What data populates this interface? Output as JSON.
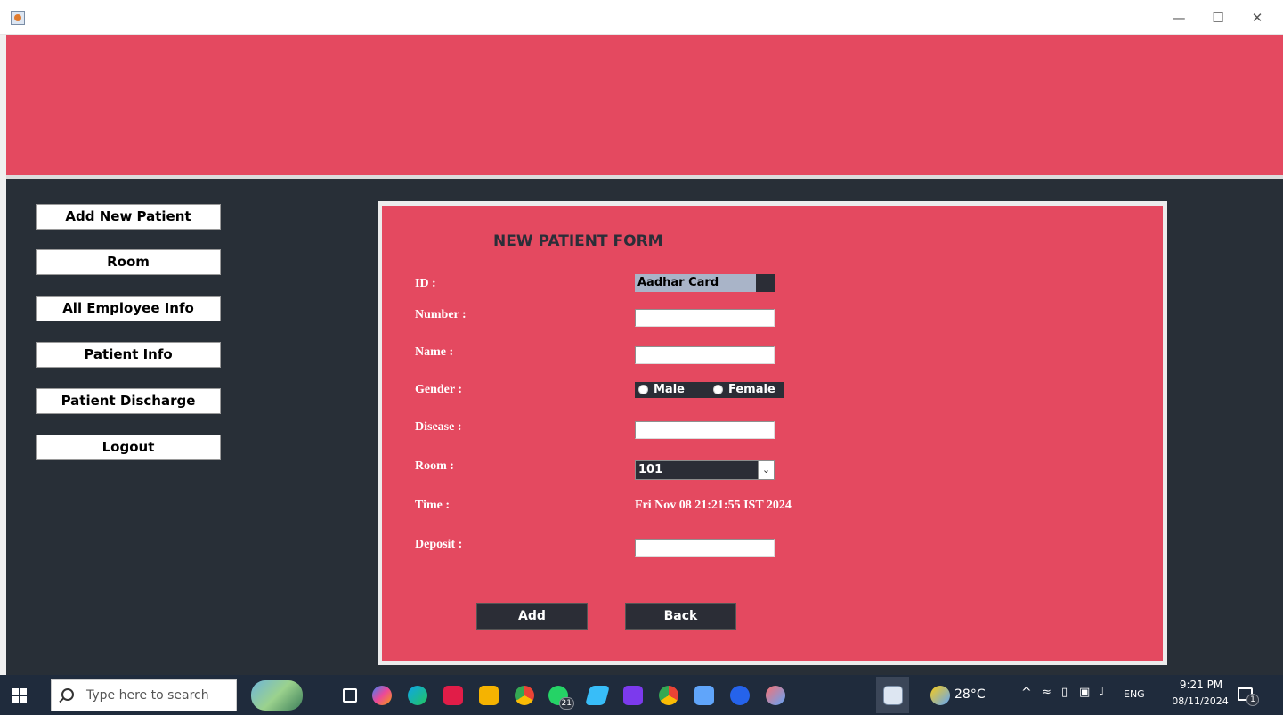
{
  "window": {
    "controls": {
      "minimize": "—",
      "maximize": "☐",
      "close": "✕"
    }
  },
  "colors": {
    "accent": "#e44960",
    "dark_background": "#282f37",
    "dark_field": "#2b2d36",
    "taskbar": "#1f2b3c"
  },
  "sidebar": {
    "items": [
      {
        "label": "Add New Patient"
      },
      {
        "label": "Room"
      },
      {
        "label": "All Employee Info"
      },
      {
        "label": "Patient Info"
      },
      {
        "label": "Patient Discharge"
      },
      {
        "label": "Logout"
      }
    ]
  },
  "form": {
    "title": "NEW PATIENT FORM",
    "labels": {
      "id": "ID :",
      "number": "Number :",
      "name": "Name :",
      "gender": "Gender :",
      "disease": "Disease :",
      "room": "Room :",
      "time": "Time :",
      "deposit": "Deposit :"
    },
    "id_type": {
      "selected": "Aadhar Card"
    },
    "number_value": "",
    "name_value": "",
    "disease_value": "",
    "deposit_value": "",
    "gender_options": [
      "Male",
      "Female"
    ],
    "room": {
      "selected": "101"
    },
    "time_value": "Fri Nov 08 21:21:55 IST 2024",
    "buttons": {
      "add": "Add",
      "back": "Back"
    }
  },
  "taskbar": {
    "search_placeholder": "Type here to search",
    "icons": [
      {
        "name": "task-view-icon"
      },
      {
        "name": "copilot-icon"
      },
      {
        "name": "edge-icon"
      },
      {
        "name": "store-icon"
      },
      {
        "name": "file-explorer-icon"
      },
      {
        "name": "chrome-icon"
      },
      {
        "name": "whatsapp-icon",
        "badge": "21"
      },
      {
        "name": "notes-icon"
      },
      {
        "name": "intellij-icon"
      },
      {
        "name": "chrome-profile-icon"
      },
      {
        "name": "remote-desktop-icon"
      },
      {
        "name": "browser-icon"
      },
      {
        "name": "paint-icon"
      },
      {
        "name": "java-app-icon"
      }
    ],
    "weather": "28°C",
    "language": "ENG",
    "time": "9:21 PM",
    "date": "08/11/2024",
    "notification_count": "1"
  }
}
